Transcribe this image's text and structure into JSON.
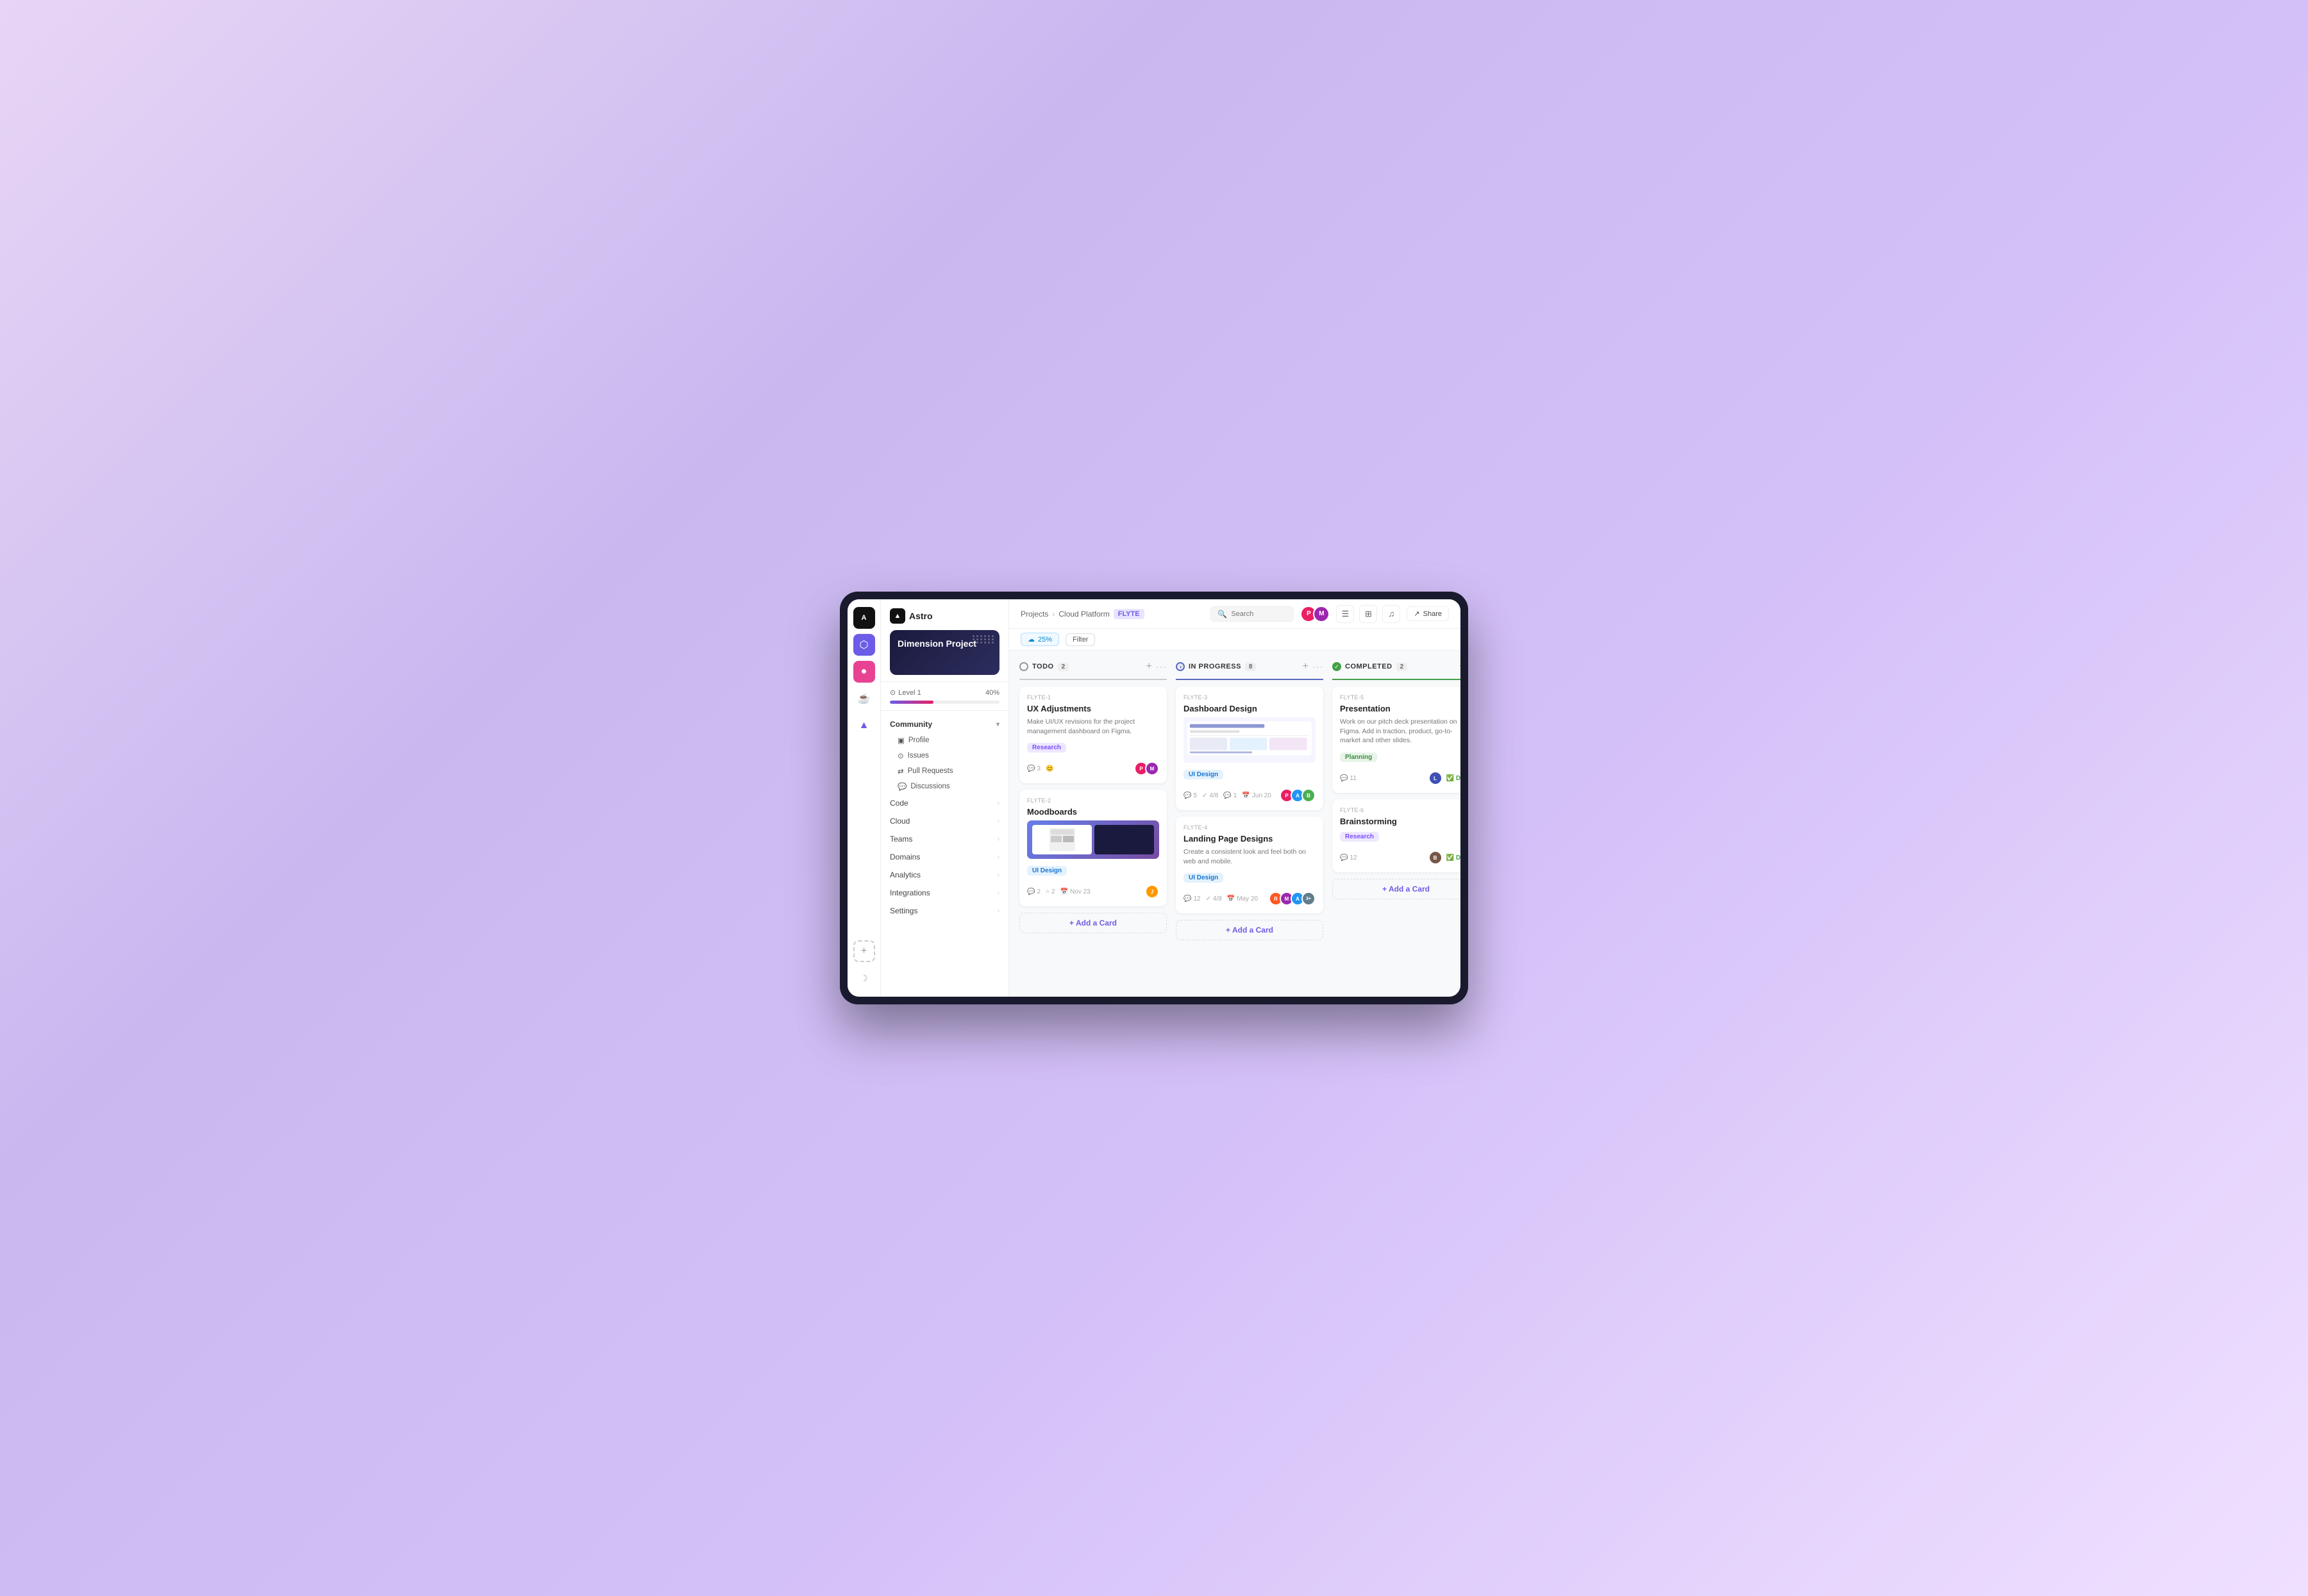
{
  "app": {
    "name": "Astro",
    "logo_icon": "A"
  },
  "breadcrumb": {
    "projects": "Projects",
    "platform": "Cloud Platform",
    "tag": "FLYTE"
  },
  "topbar": {
    "search_placeholder": "Search",
    "share_label": "Share",
    "filter_label": "Filter",
    "filter_chip_label": "25%"
  },
  "sidebar": {
    "project_title": "Dimension Project",
    "level_label": "Level 1",
    "level_pct": "40%",
    "progress_value": 40,
    "nav_groups": [
      {
        "label": "Community",
        "expanded": true,
        "sub_items": [
          {
            "label": "Profile",
            "icon": "👤"
          },
          {
            "label": "Issues",
            "icon": "⊙"
          },
          {
            "label": "Pull Requests",
            "icon": "⇄"
          },
          {
            "label": "Discussions",
            "icon": "💬"
          }
        ]
      },
      {
        "label": "Code",
        "expanded": false,
        "sub_items": []
      },
      {
        "label": "Cloud",
        "expanded": false,
        "sub_items": []
      },
      {
        "label": "Teams",
        "expanded": false,
        "sub_items": []
      },
      {
        "label": "Domains",
        "expanded": false,
        "sub_items": []
      },
      {
        "label": "Analytics",
        "expanded": false,
        "sub_items": []
      },
      {
        "label": "Integrations",
        "expanded": false,
        "sub_items": []
      },
      {
        "label": "Settings",
        "expanded": false,
        "sub_items": []
      }
    ]
  },
  "columns": [
    {
      "id": "todo",
      "title": "TODO",
      "count": "2",
      "type": "todo",
      "cards": [
        {
          "id": "FLYTE-1",
          "title": "UX Adjustments",
          "desc": "Make UI/UX revisions for the project management dashboard on Figma.",
          "tag": "Research",
          "tag_class": "tag-research",
          "comments": "3",
          "avatars": [
            "#e91e63",
            "#9c27b0"
          ],
          "has_done": false,
          "has_image": false,
          "has_date": false,
          "date": ""
        },
        {
          "id": "FLYTE-2",
          "title": "Moodboards",
          "desc": "",
          "tag": "UI Design",
          "tag_class": "tag-ui-design",
          "comments": "2",
          "forks": "2",
          "date": "Nov 23",
          "avatars": [
            "#ff9800"
          ],
          "has_done": false,
          "has_image": true
        }
      ]
    },
    {
      "id": "inprogress",
      "title": "IN PROGRESS",
      "count": "8",
      "type": "inprogress",
      "cards": [
        {
          "id": "FLYTE-3",
          "title": "Dashboard Design",
          "desc": "",
          "tag": "UI Design",
          "tag_class": "tag-ui-design",
          "comments": "5",
          "checks": "4/8",
          "comment_count": "1",
          "date": "Jun 20",
          "avatars": [
            "#e91e63",
            "#2196f3",
            "#4caf50"
          ],
          "has_done": false,
          "has_dashboard_image": true
        },
        {
          "id": "FLYTE-4",
          "title": "Landing Page Designs",
          "desc": "Create a consistent look and feel both on web and mobile.",
          "tag": "UI Design",
          "tag_class": "tag-ui-design",
          "comments": "12",
          "checks": "4/8",
          "date": "May 20",
          "avatars": [
            "#ff5722",
            "#9c27b0",
            "#2196f3"
          ],
          "extra_count": "3+",
          "has_done": false
        }
      ]
    },
    {
      "id": "completed",
      "title": "COMPLETED",
      "count": "2",
      "type": "completed",
      "cards": [
        {
          "id": "FLYTE-5",
          "title": "Presentation",
          "desc": "Work on our pitch deck presentation on Figma. Add in traction, product, go-to-market and other slides.",
          "tag": "Planning",
          "tag_class": "tag-planning",
          "comments": "11",
          "avatars": [
            "#3f51b5"
          ],
          "has_done": true,
          "done_label": "Done"
        },
        {
          "id": "FLYTE-6",
          "title": "Brainstorming",
          "desc": "",
          "tag": "Research",
          "tag_class": "tag-research",
          "comments": "12",
          "avatars": [
            "#795548"
          ],
          "has_done": true,
          "done_label": "Done"
        }
      ]
    }
  ],
  "add_card_label": "+ Add a Card"
}
